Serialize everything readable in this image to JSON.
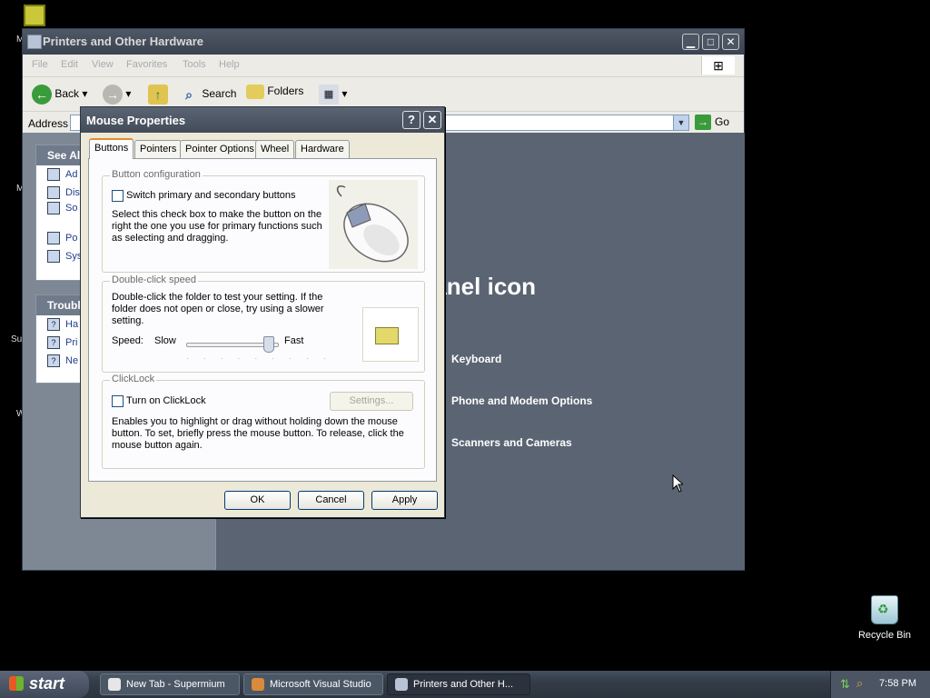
{
  "desktop": {
    "edge_labels": [
      "M",
      "M",
      "Su",
      "W"
    ],
    "recycle_bin_label": "Recycle Bin"
  },
  "explorer": {
    "title": "Printers and Other Hardware",
    "menu": [
      "File",
      "Edit",
      "View",
      "Favorites",
      "Tools",
      "Help"
    ],
    "toolbar": {
      "back_label": "Back",
      "search_label": "Search",
      "folders_label": "Folders"
    },
    "address": {
      "label": "Address",
      "go_label": "Go"
    },
    "see_also": {
      "header": "See Al",
      "items": [
        "Ad",
        "Dis",
        "So Au",
        "Po",
        "Sys"
      ]
    },
    "troubleshooters": {
      "header": "Troubl",
      "items": [
        "Ha",
        "Pri",
        "Ne"
      ]
    },
    "right_title": "Panel icon",
    "right_items": [
      "Keyboard",
      "Phone and Modem Options",
      "Scanners and Cameras"
    ]
  },
  "dialog": {
    "title": "Mouse Properties",
    "help_btn": "?",
    "close_btn": "✕",
    "tabs": [
      "Buttons",
      "Pointers",
      "Pointer Options",
      "Wheel",
      "Hardware"
    ],
    "active_tab": "Buttons",
    "button_config": {
      "label": "Button configuration",
      "checkbox_label": "Switch primary and secondary buttons",
      "checked": false,
      "description": "Select this check box to make the button on the right the one you use for primary functions such as selecting and dragging."
    },
    "double_click": {
      "label": "Double-click speed",
      "description": "Double-click the folder to test your setting. If the folder does not open or close, try using a slower setting.",
      "speed_label": "Speed:",
      "slow_label": "Slow",
      "fast_label": "Fast",
      "level": 0.9
    },
    "clicklock": {
      "label": "ClickLock",
      "checkbox_label": "Turn on ClickLock",
      "checked": false,
      "settings_label": "Settings...",
      "description": "Enables you to highlight or drag without holding down the mouse button. To set, briefly press the mouse button. To release, click the mouse button again."
    },
    "buttons": {
      "ok": "OK",
      "cancel": "Cancel",
      "apply": "Apply"
    }
  },
  "taskbar": {
    "start_label": "start",
    "tasks": [
      {
        "label": "New Tab - Supermium",
        "active": false
      },
      {
        "label": "Microsoft Visual Studio",
        "active": false
      },
      {
        "label": "Printers and Other H...",
        "active": true
      }
    ],
    "clock": "7:58 PM"
  },
  "colors": {
    "accent_tab": "#e68b2c",
    "title_bar": "#4f5866",
    "link": "#1c3d8c"
  }
}
